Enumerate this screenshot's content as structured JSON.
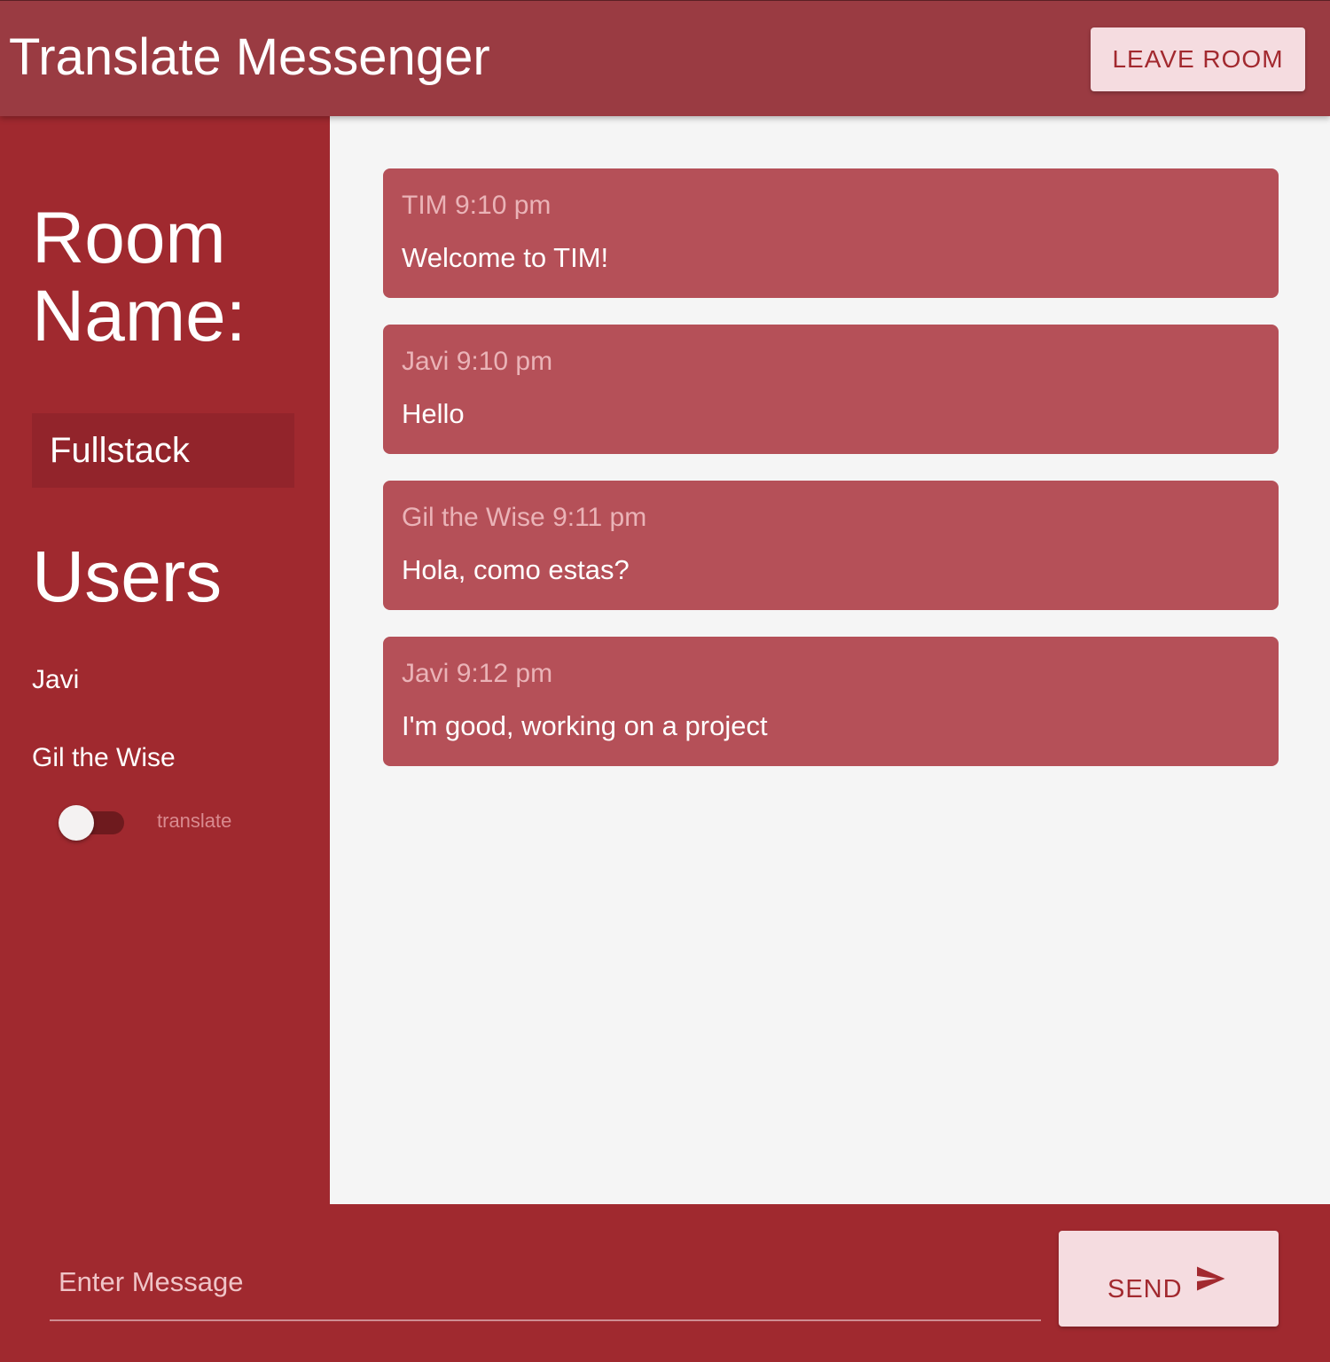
{
  "app": {
    "title": "Translate Messenger",
    "leave_label": "LEAVE ROOM"
  },
  "sidebar": {
    "room_heading": "Room Name:",
    "room_name": "Fullstack",
    "users_heading": "Users",
    "users": [
      "Javi",
      "Gil the Wise"
    ],
    "translate_label": "translate",
    "translate_on": false
  },
  "messages": [
    {
      "author": "TIM",
      "time": "9:10 pm",
      "text": "Welcome to TIM!"
    },
    {
      "author": "Javi",
      "time": "9:10 pm",
      "text": "Hello"
    },
    {
      "author": "Gil the Wise",
      "time": "9:11 pm",
      "text": "Hola, como estas?"
    },
    {
      "author": "Javi",
      "time": "9:12 pm",
      "text": "I'm good, working on a project"
    }
  ],
  "composer": {
    "placeholder": "Enter Message",
    "value": "",
    "send_label": "SEND",
    "send_icon": "send-icon"
  },
  "colors": {
    "appbar": "#9a3b42",
    "sidebar": "#a0292f",
    "message_bubble": "#b55058",
    "button_bg": "#f5dce0",
    "button_text": "#a2292f"
  }
}
